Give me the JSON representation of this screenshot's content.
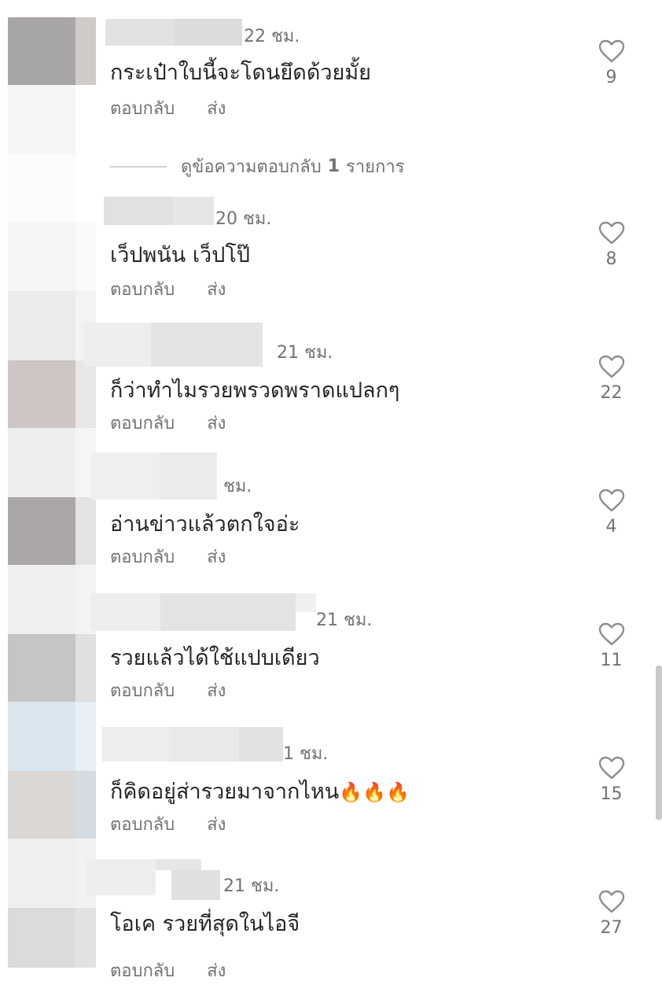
{
  "view_replies": {
    "label": "ดูข้อความตอบกลับ",
    "count": "1",
    "suffix": "รายการ"
  },
  "action_labels": {
    "reply": "ตอบกลับ",
    "send": "ส่ง"
  },
  "comments": [
    {
      "time": "22 ชม.",
      "text": "กระเป๋าใบนี้จะโดนยึดด้วยมั้ย",
      "likes": "9"
    },
    {
      "time": "20 ชม.",
      "text": "เว็ปพนัน เว็ปโป๊",
      "likes": "8"
    },
    {
      "time": "21 ชม.",
      "text": "ก็ว่าทำไมรวยพรวดพราดแปลกๆ",
      "likes": "22"
    },
    {
      "time": "ชม.",
      "text": "อ่านข่าวแล้วตกใจอ่ะ",
      "likes": "4"
    },
    {
      "time": "21 ชม.",
      "text": "รวยแล้วได้ใช้แปบเดียว",
      "likes": "11"
    },
    {
      "time": "1 ชม.",
      "text": "ก็คิดอยู่ส่ารวยมาจากไหน",
      "emoji": "🔥🔥🔥",
      "likes": "15"
    },
    {
      "time": "21 ชม.",
      "text": "โอเค รวยที่สุดในไอจี",
      "likes": "27"
    }
  ]
}
